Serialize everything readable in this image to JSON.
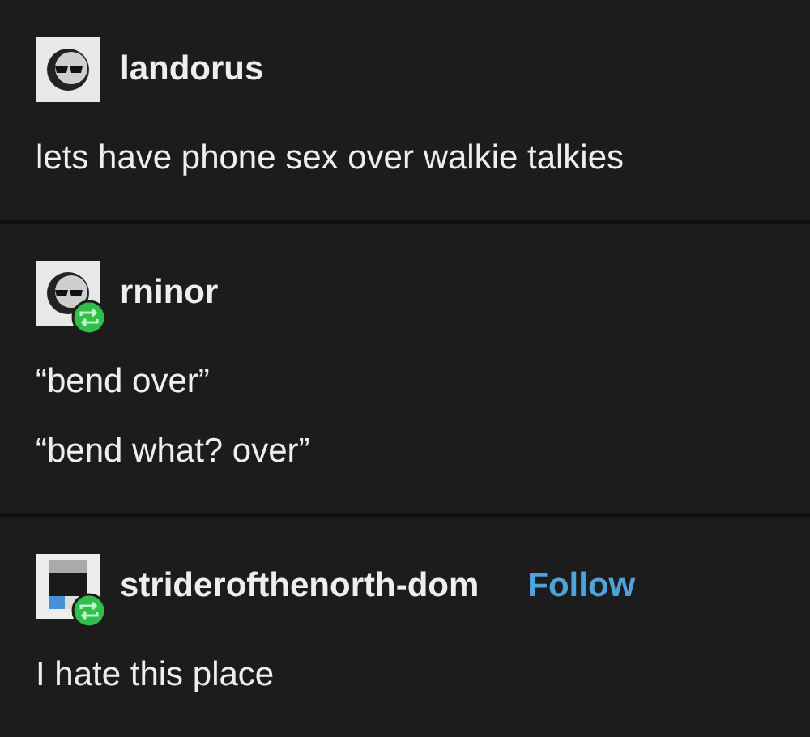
{
  "posts": [
    {
      "username": "landorus",
      "avatar": {
        "kind": "sunglasses"
      },
      "reblogged": false,
      "lines": [
        "lets have phone sex over walkie talkies"
      ]
    },
    {
      "username": "rninor",
      "avatar": {
        "kind": "sunglasses"
      },
      "reblogged": true,
      "lines": [
        "“bend over”",
        "“bend what? over”"
      ]
    },
    {
      "username": "striderofthenorth-dom",
      "avatar": {
        "kind": "pixel"
      },
      "reblogged": true,
      "follow": "Follow",
      "lines": [
        "I hate this place"
      ]
    }
  ]
}
